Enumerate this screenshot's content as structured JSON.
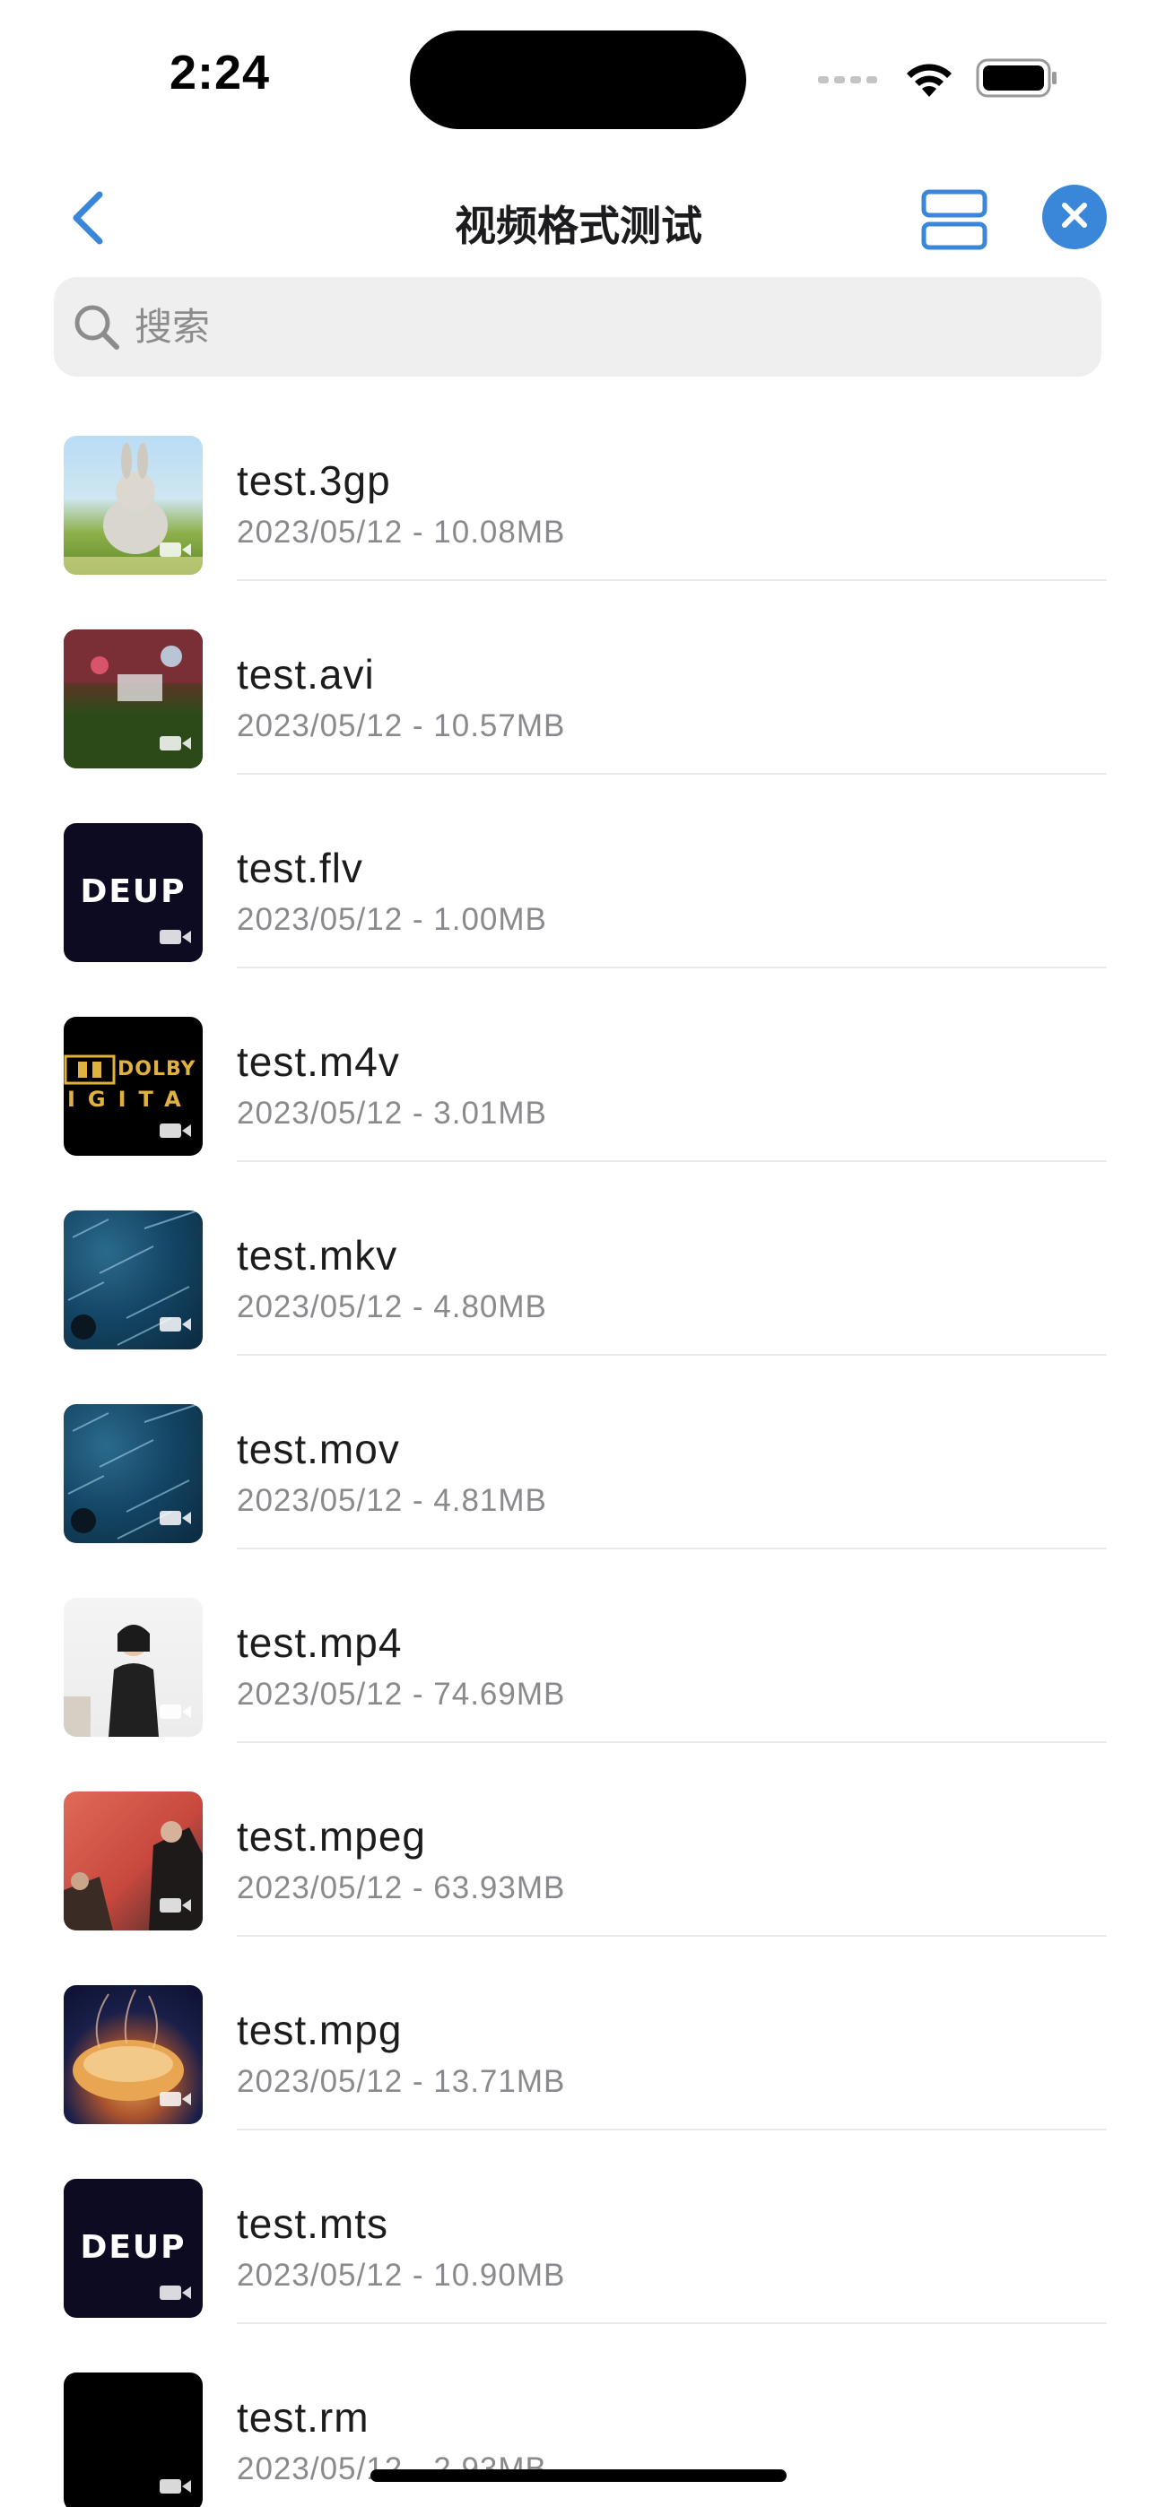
{
  "status_bar": {
    "time": "2:24"
  },
  "nav": {
    "title": "视频格式测试"
  },
  "search": {
    "placeholder": "搜索"
  },
  "files": [
    {
      "name": "test.3gp",
      "meta": "2023/05/12 - 10.08MB",
      "thumb": "bunny"
    },
    {
      "name": "test.avi",
      "meta": "2023/05/12 - 10.57MB",
      "thumb": "garden"
    },
    {
      "name": "test.flv",
      "meta": "2023/05/12 - 1.00MB",
      "thumb": "deup"
    },
    {
      "name": "test.m4v",
      "meta": "2023/05/12 - 3.01MB",
      "thumb": "dolby"
    },
    {
      "name": "test.mkv",
      "meta": "2023/05/12 - 4.80MB",
      "thumb": "space"
    },
    {
      "name": "test.mov",
      "meta": "2023/05/12 - 4.81MB",
      "thumb": "space"
    },
    {
      "name": "test.mp4",
      "meta": "2023/05/12 - 74.69MB",
      "thumb": "person"
    },
    {
      "name": "test.mpeg",
      "meta": "2023/05/12 - 63.93MB",
      "thumb": "red-stage"
    },
    {
      "name": "test.mpg",
      "meta": "2023/05/12 - 13.71MB",
      "thumb": "jellyfish"
    },
    {
      "name": "test.mts",
      "meta": "2023/05/12 - 10.90MB",
      "thumb": "deup"
    },
    {
      "name": "test.rm",
      "meta": "2023/05/12 - 2.93MB",
      "thumb": "black"
    }
  ],
  "thumb_labels": {
    "deup": "DEUP",
    "dolby_top": "DOLBY",
    "dolby_bottom": "IGITA"
  },
  "icons": {
    "back": "chevron-left-icon",
    "layout": "list-layout-icon",
    "close": "close-icon",
    "search": "search-icon",
    "camera": "video-camera-icon"
  },
  "colors": {
    "accent": "#3a86d8",
    "secondary_text": "#8a8a8e",
    "search_bg": "#efefef"
  }
}
